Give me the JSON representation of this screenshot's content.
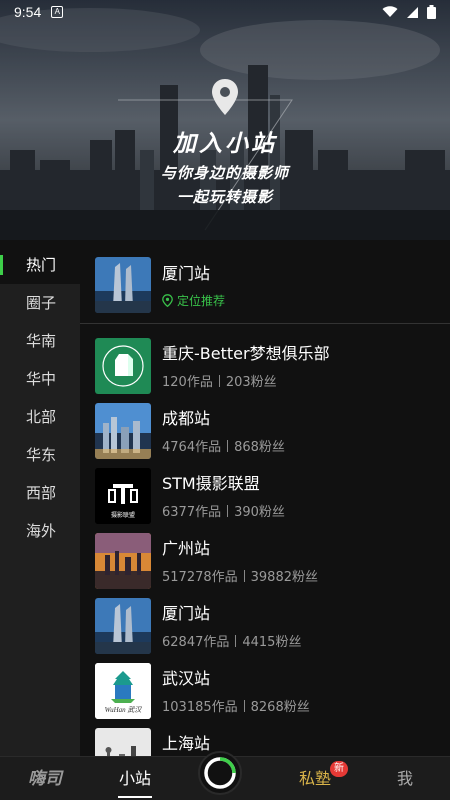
{
  "status_bar": {
    "time": "9:54",
    "notif_glyph": "A"
  },
  "hero": {
    "title": "加入小站",
    "subtitle_line1": "与你身边的摄影师",
    "subtitle_line2": "一起玩转摄影"
  },
  "sidebar": {
    "items": [
      {
        "label": "热门",
        "active": true
      },
      {
        "label": "圈子"
      },
      {
        "label": "华南"
      },
      {
        "label": "华中"
      },
      {
        "label": "北部"
      },
      {
        "label": "华东"
      },
      {
        "label": "西部"
      },
      {
        "label": "海外"
      }
    ]
  },
  "featured": {
    "name": "厦门站",
    "location_label": "定位推荐"
  },
  "stations": [
    {
      "name": "重庆-Better梦想俱乐部",
      "works": "120作品",
      "fans": "203粉丝"
    },
    {
      "name": "成都站",
      "works": "4764作品",
      "fans": "868粉丝"
    },
    {
      "name": "STM摄影联盟",
      "works": "6377作品",
      "fans": "390粉丝",
      "logo_text": "摄影联盟"
    },
    {
      "name": "广州站",
      "works": "517278作品",
      "fans": "39882粉丝"
    },
    {
      "name": "厦门站",
      "works": "62847作品",
      "fans": "4415粉丝"
    },
    {
      "name": "武汉站",
      "works": "103185作品",
      "fans": "8268粉丝",
      "logo_text": "WuHan 武汉"
    },
    {
      "name": "上海站",
      "works": "",
      "fans": ""
    }
  ],
  "bottom_nav": {
    "items": [
      "嗨司",
      "小站",
      "私塾",
      "我"
    ],
    "badge": "新"
  },
  "colors": {
    "accent": "#3ecf4a",
    "badge": "#e53935",
    "private": "#d9b44a"
  }
}
